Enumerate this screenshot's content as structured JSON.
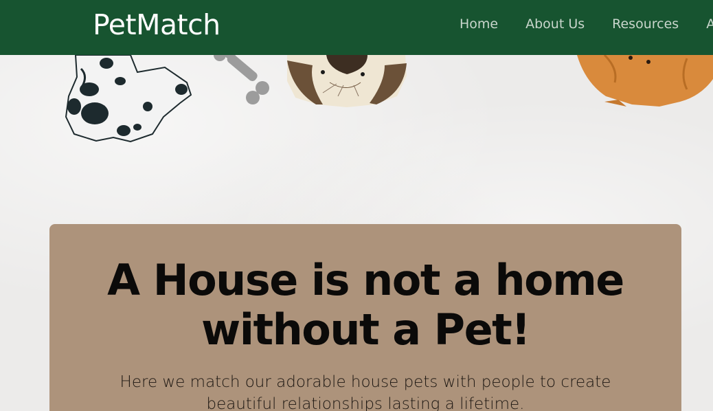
{
  "navbar": {
    "brand": "PetMatch",
    "links": [
      "Home",
      "About Us",
      "Resources",
      "Ac"
    ],
    "background": "#175430"
  },
  "hero": {
    "title_line1": "A House is not a home",
    "title_line2": "without a Pet!",
    "subtitle": "Here we match our adorable house pets with people to create beautiful relationships lasting a lifetime.",
    "card_color": "#ad937b"
  },
  "illustrations": [
    "dalmatian-icon",
    "bone-icon",
    "siamese-cat-icon",
    "orange-cat-icon"
  ]
}
